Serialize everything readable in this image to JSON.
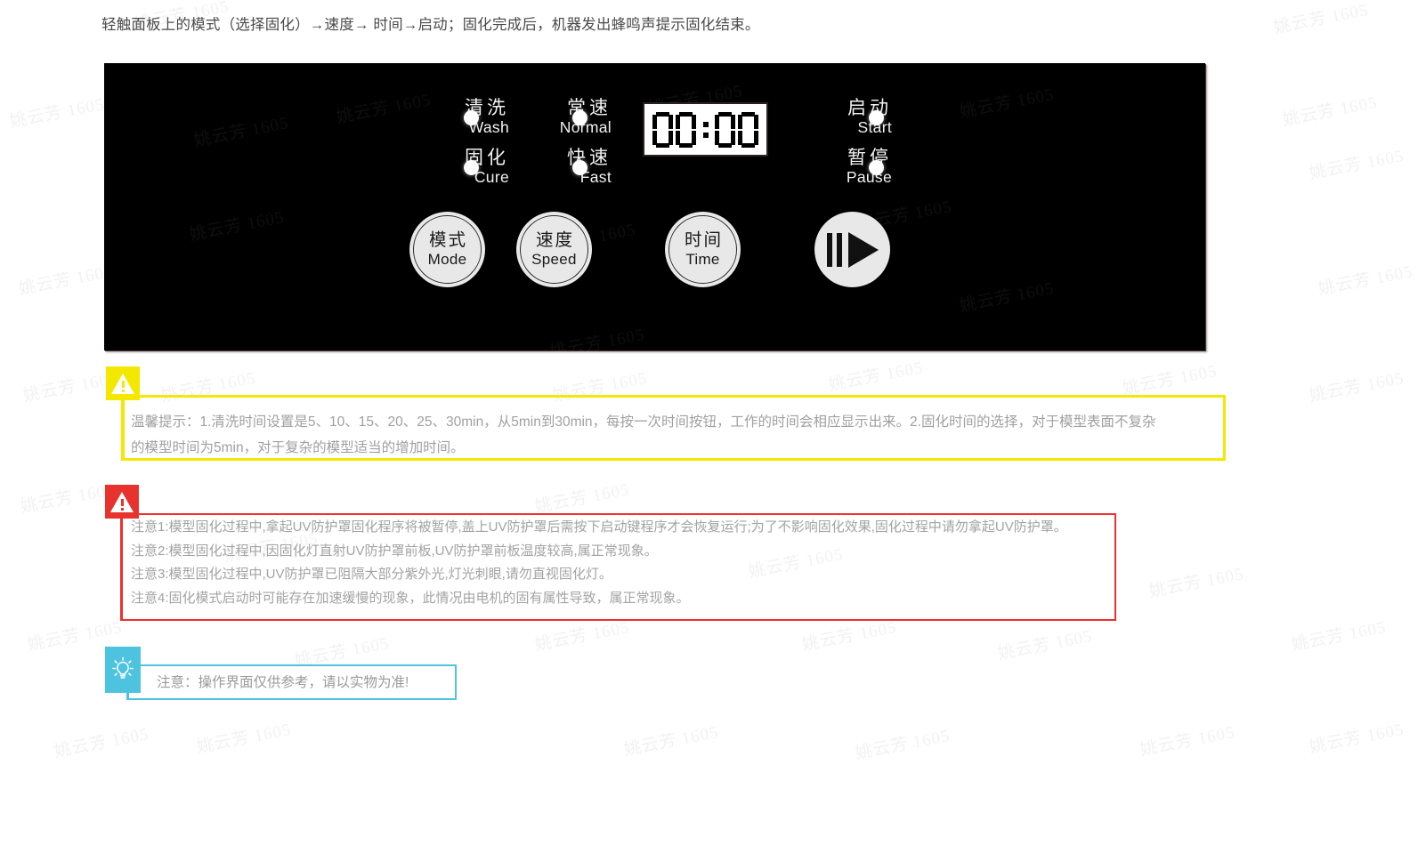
{
  "intro": {
    "text": "轻触面板上的模式（选择固化）→速度→ 时间→启动；固化完成后，机器发出蜂鸣声提示固化结束。"
  },
  "watermark": {
    "text": "姚云芳 1605"
  },
  "panel": {
    "background_color": "#000000",
    "leds": [
      {
        "cn": "清洗",
        "en": "Wash",
        "indicator": "led-dot",
        "state": "on"
      },
      {
        "cn": "固化",
        "en": "Cure",
        "indicator": "led-dot",
        "state": "on"
      },
      {
        "cn": "常速",
        "en": "Normal",
        "indicator": "led-dot",
        "state": "on"
      },
      {
        "cn": "快速",
        "en": "Fast",
        "indicator": "led-dot",
        "state": "on"
      },
      {
        "cn": "启动",
        "en": "Start",
        "indicator": "led-dot",
        "state": "on"
      },
      {
        "cn": "暂停",
        "en": "Pause",
        "indicator": "led-dot",
        "state": "on"
      }
    ],
    "display": {
      "value": "00:00",
      "digits": [
        "0",
        "0",
        "0",
        "0"
      ],
      "separator": ":",
      "background_color": "#ffffff",
      "segment_color": "#000000"
    },
    "buttons": [
      {
        "cn": "模式",
        "en": "Mode",
        "icon": "none"
      },
      {
        "cn": "速度",
        "en": "Speed",
        "icon": "none"
      },
      {
        "cn": "时间",
        "en": "Time",
        "icon": "none"
      },
      {
        "cn": "",
        "en": "",
        "icon": "play-pause-icon"
      }
    ]
  },
  "callouts": {
    "yellow": {
      "accent_color": "#f5e800",
      "icon": "warning-triangle-icon",
      "lines": [
        "温馨提示：1.清洗时间设置是5、10、15、20、25、30min，从5min到30min，每按一次时间按钮，工作的时间会相应显示出来。2.固化时间的选择，对于模型表面不复杂",
        "的模型时间为5min，对于复杂的模型适当的增加时间。"
      ]
    },
    "red": {
      "accent_color": "#ee2f2c",
      "icon": "warning-triangle-icon",
      "lines": [
        "注意1:模型固化过程中,拿起UV防护罩固化程序将被暂停,盖上UV防护罩后需按下启动键程序才会恢复运行;为了不影响固化效果,固化过程中请勿拿起UV防护罩。",
        "注意2:模型固化过程中,因固化灯直射UV防护罩前板,UV防护罩前板温度较高,属正常现象。",
        "注意3:模型固化过程中,UV防护罩已阻隔大部分紫外光,灯光刺眼,请勿直视固化灯。",
        "注意4:固化模式启动时可能存在加速缓慢的现象，此情况由电机的固有属性导致，属正常现象。"
      ]
    },
    "cyan": {
      "accent_color": "#4ec3e0",
      "icon": "lightbulb-icon",
      "lines": [
        "注意：操作界面仅供参考，请以实物为准!"
      ]
    }
  }
}
